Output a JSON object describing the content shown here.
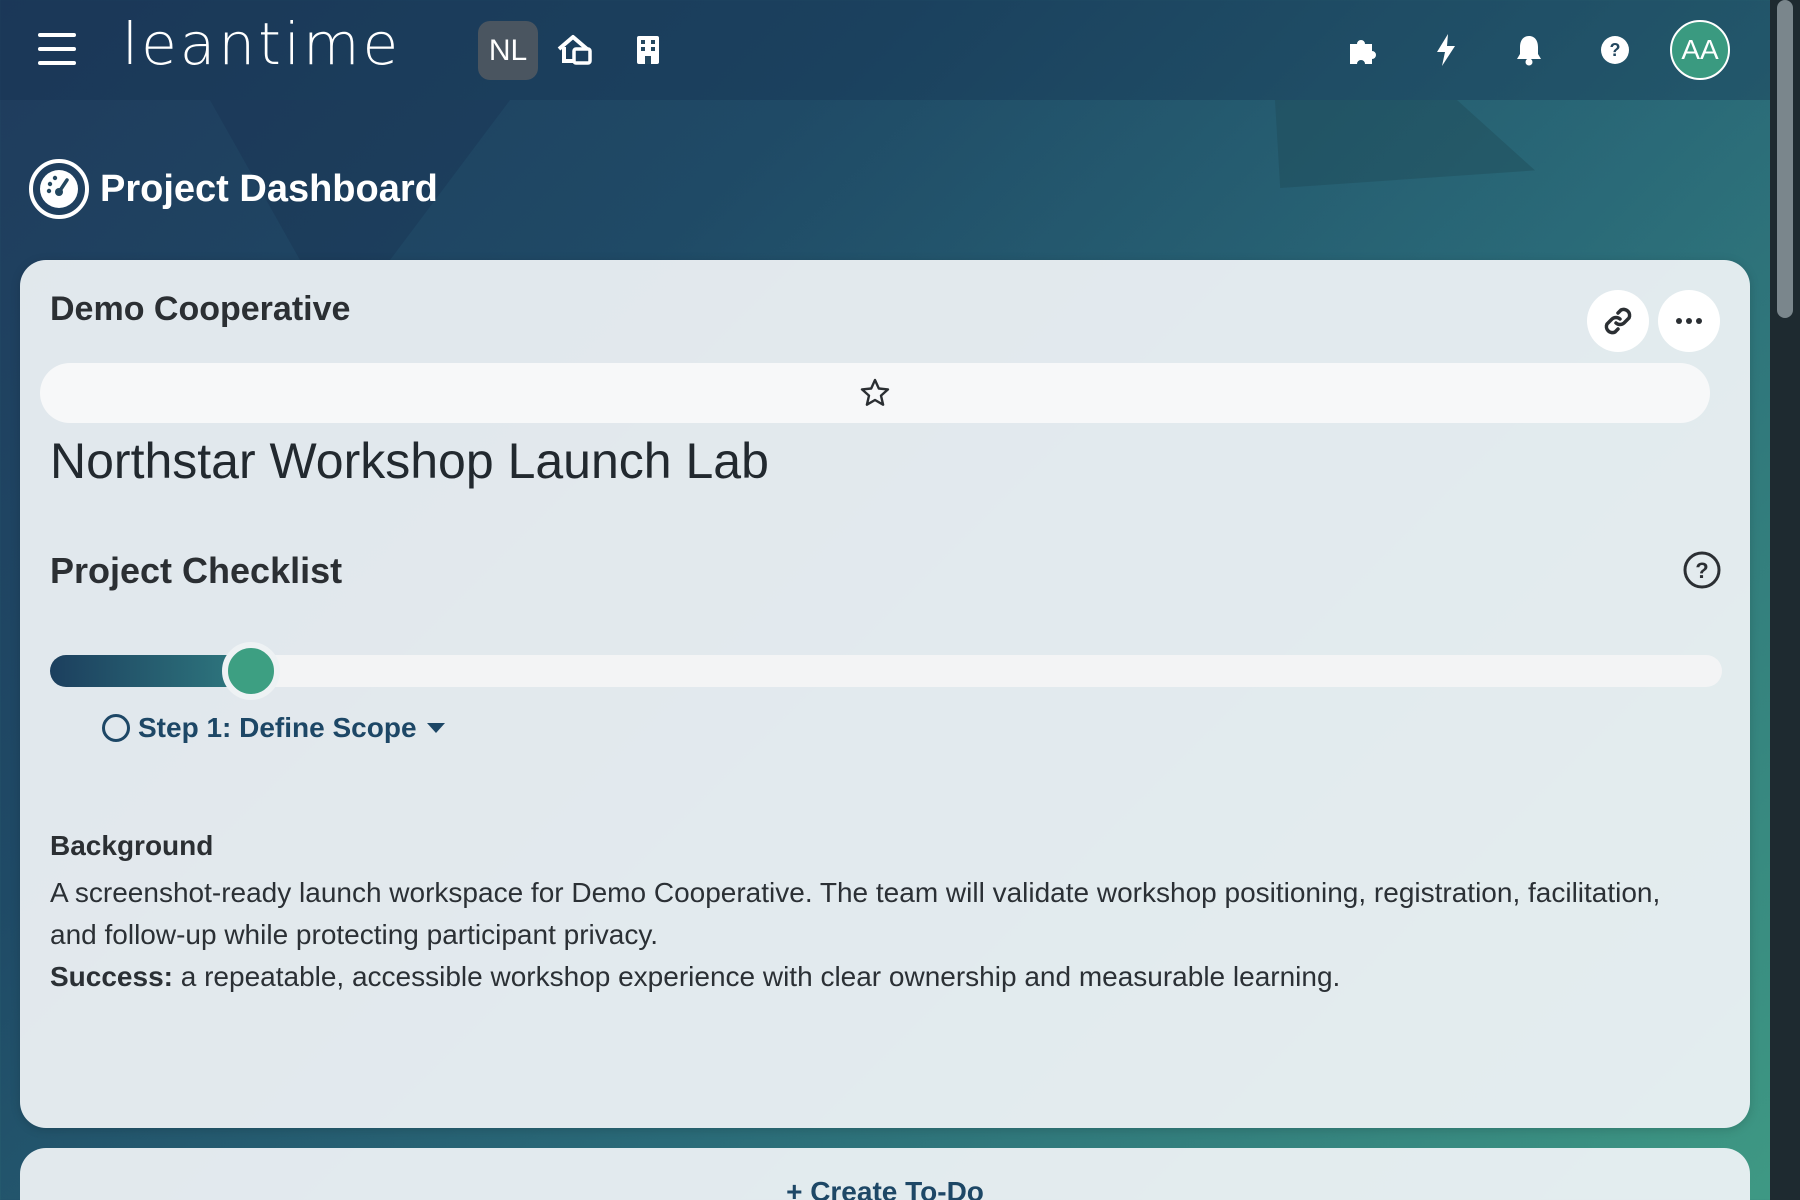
{
  "topbar": {
    "logo_text": "leantime",
    "project_initials": "NL",
    "user_initials": "AA",
    "icons": [
      "menu-icon",
      "project-home-icon",
      "company-icon",
      "puzzle-icon",
      "lightning-icon",
      "bell-icon",
      "help-icon"
    ]
  },
  "page": {
    "title": "Project Dashboard"
  },
  "project_card": {
    "client_name": "Demo Cooperative",
    "project_name": "Northstar Workshop Launch Lab",
    "checklist_title": "Project Checklist",
    "progress_fraction": 0.12,
    "current_step": "Step 1: Define Scope",
    "background_heading": "Background",
    "background_text": "A screenshot-ready launch workspace for Demo Cooperative. The team will validate workshop positioning, registration, facilitation, and follow-up while protecting participant privacy.",
    "success_label": "Success:",
    "success_text": " a repeatable, accessible workshop experience with clear ownership and measurable learning."
  },
  "todo_card": {
    "create_label": "+ Create To-Do"
  },
  "colors": {
    "accent_teal": "#3d9f82",
    "primary_navy": "#1d4766"
  }
}
